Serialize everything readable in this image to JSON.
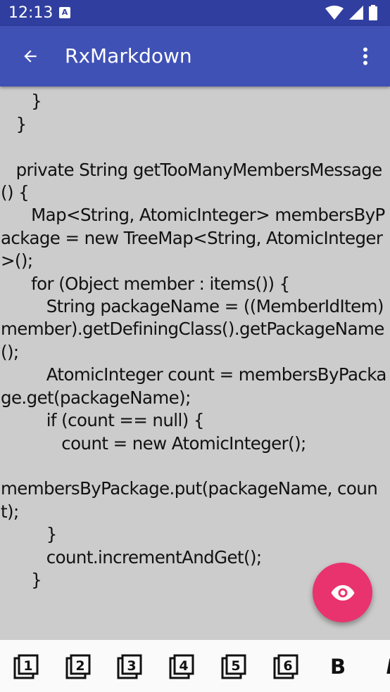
{
  "status_bar": {
    "time": "12:13",
    "notification_icon": "a-box-icon",
    "icons": [
      "wifi-icon",
      "signal-icon",
      "battery-icon"
    ]
  },
  "app_bar": {
    "title": "RxMarkdown",
    "back_icon": "arrow-back-icon",
    "menu_icon": "more-vert-icon",
    "color": "#3f51b5",
    "status_color": "#303f9f"
  },
  "editor": {
    "text": "            fix = ;\n      }\n   }\n\n   private String getTooManyMembersMessage() {\n      Map<String, AtomicInteger> membersByPackage = new TreeMap<String, AtomicInteger>();\n      for (Object member : items()) {\n         String packageName = ((MemberIdItem) member).getDefiningClass().getPackageName();\n         AtomicInteger count = membersByPackage.get(packageName);\n         if (count == null) {\n            count = new AtomicInteger();\n\nmembersByPackage.put(packageName, count);\n         }\n         count.incrementAndGet();\n      }"
  },
  "fab": {
    "icon": "eye-icon",
    "color": "#e9336e"
  },
  "toolbar": {
    "h1": "1",
    "h2": "2",
    "h3": "3",
    "h4": "4",
    "h5": "5",
    "h6": "6",
    "bold": "B",
    "italic": "I"
  }
}
